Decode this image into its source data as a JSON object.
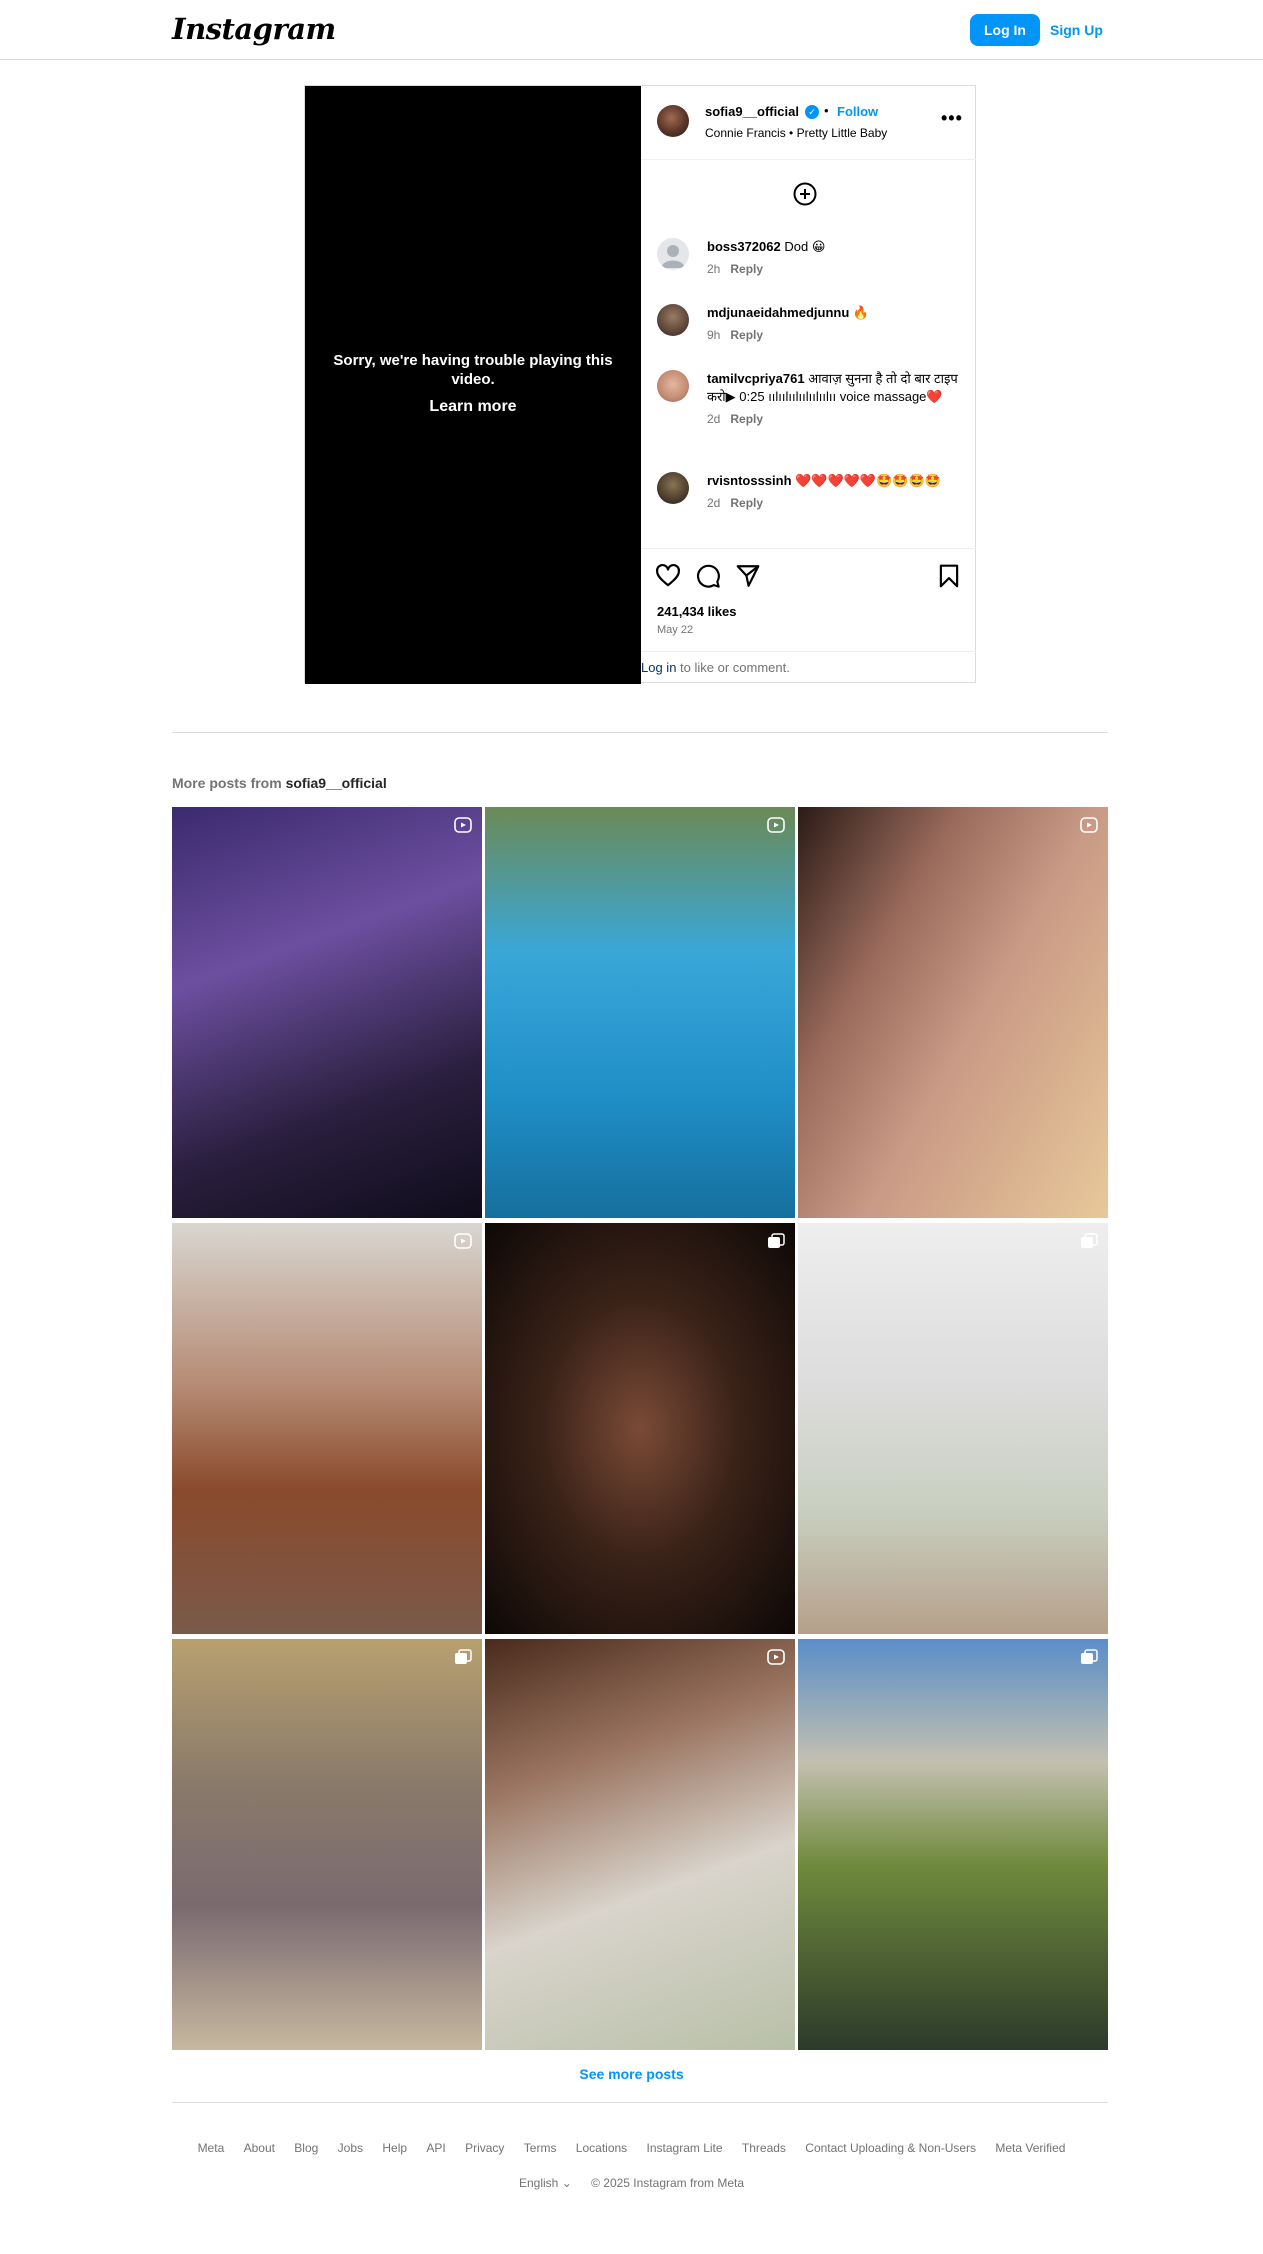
{
  "header": {
    "logo": "Instagram",
    "login_label": "Log In",
    "signup_label": "Sign Up"
  },
  "post": {
    "video_error": "Sorry, we're having trouble playing this video.",
    "video_learn_more": "Learn more",
    "username": "sofia9__official",
    "follow_label": "Follow",
    "separator": "•",
    "audio": "Connie Francis • Pretty Little Baby",
    "comments": [
      {
        "user": "boss372062",
        "text": "Dod 😀",
        "time": "2h",
        "reply": "Reply"
      },
      {
        "user": "mdjunaeidahmedjunnu",
        "text": "🔥",
        "time": "9h",
        "reply": "Reply"
      },
      {
        "user": "tamilvcpriya761",
        "text": "आवाज़ सुनना है तो दो बार टाइप करो▶ 0:25 ıılıılıılıılıılıılıı voice massage❤️",
        "time": "2d",
        "reply": "Reply"
      },
      {
        "user": "rvisntosssinh",
        "text": "❤️❤️❤️❤️❤️🤩🤩🤩🤩",
        "time": "2d",
        "reply": "Reply"
      }
    ],
    "likes": "241,434 likes",
    "date": "May 22",
    "login_link": "Log in",
    "login_rest": " to like or comment."
  },
  "more_posts": {
    "prefix": "More posts from ",
    "username": "sofia9__official",
    "tiles": [
      {
        "badge": "reel-icon"
      },
      {
        "badge": "reel-icon"
      },
      {
        "badge": "reel-icon"
      },
      {
        "badge": "reel-icon"
      },
      {
        "badge": "carousel-icon"
      },
      {
        "badge": "carousel-icon"
      },
      {
        "badge": "carousel-icon"
      },
      {
        "badge": "reel-icon"
      },
      {
        "badge": "carousel-icon"
      }
    ],
    "see_more": "See more posts"
  },
  "footer": {
    "links": [
      "Meta",
      "About",
      "Blog",
      "Jobs",
      "Help",
      "API",
      "Privacy",
      "Terms",
      "Locations",
      "Instagram Lite",
      "Threads",
      "Contact Uploading & Non-Users",
      "Meta Verified"
    ],
    "language": "English",
    "copyright": "© 2025 Instagram from Meta"
  },
  "colors": {
    "accent": "#0095f6",
    "border": "#dbdbdb",
    "muted": "#737373"
  }
}
